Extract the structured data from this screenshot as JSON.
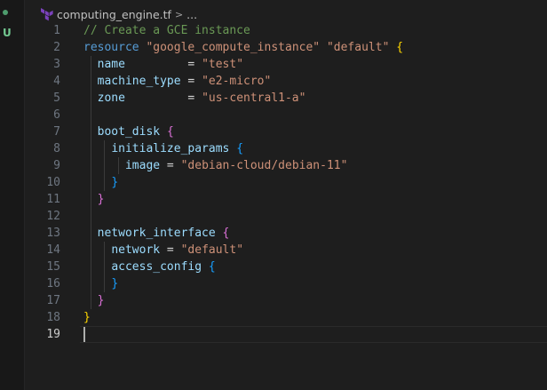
{
  "status": {
    "git_badge": "U"
  },
  "breadcrumb": {
    "file": "computing_engine.tf",
    "separator": ">",
    "more": "..."
  },
  "colors": {
    "comment": "#6a9955",
    "keyword": "#569cd6",
    "string": "#ce9178",
    "property": "#9cdcfe",
    "operator": "#d4d4d4",
    "bracket_1": "#ffd700",
    "bracket_2": "#da70d6",
    "bracket_3": "#179fff",
    "terraform_icon": "#7b42bc"
  },
  "editor": {
    "active_line": 19,
    "lines": [
      {
        "n": "1",
        "tokens": [
          {
            "t": "// Create a GCE instance",
            "c": "cm"
          }
        ]
      },
      {
        "n": "2",
        "tokens": [
          {
            "t": "resource ",
            "c": "kw"
          },
          {
            "t": "\"google_compute_instance\"",
            "c": "str"
          },
          {
            "t": " ",
            "c": "op"
          },
          {
            "t": "\"default\"",
            "c": "str"
          },
          {
            "t": " ",
            "c": "op"
          },
          {
            "t": "{",
            "c": "b1"
          }
        ]
      },
      {
        "n": "3",
        "tokens": [
          {
            "t": "  ",
            "c": "op"
          },
          {
            "t": "name",
            "c": "prop"
          },
          {
            "t": "         = ",
            "c": "op"
          },
          {
            "t": "\"test\"",
            "c": "str"
          }
        ]
      },
      {
        "n": "4",
        "tokens": [
          {
            "t": "  ",
            "c": "op"
          },
          {
            "t": "machine_type",
            "c": "prop"
          },
          {
            "t": " = ",
            "c": "op"
          },
          {
            "t": "\"e2-micro\"",
            "c": "str"
          }
        ]
      },
      {
        "n": "5",
        "tokens": [
          {
            "t": "  ",
            "c": "op"
          },
          {
            "t": "zone",
            "c": "prop"
          },
          {
            "t": "         = ",
            "c": "op"
          },
          {
            "t": "\"us-central1-a\"",
            "c": "str"
          }
        ]
      },
      {
        "n": "6",
        "tokens": []
      },
      {
        "n": "7",
        "tokens": [
          {
            "t": "  ",
            "c": "op"
          },
          {
            "t": "boot_disk",
            "c": "prop"
          },
          {
            "t": " ",
            "c": "op"
          },
          {
            "t": "{",
            "c": "b2"
          }
        ]
      },
      {
        "n": "8",
        "tokens": [
          {
            "t": "    ",
            "c": "op"
          },
          {
            "t": "initialize_params",
            "c": "prop"
          },
          {
            "t": " ",
            "c": "op"
          },
          {
            "t": "{",
            "c": "b3"
          }
        ]
      },
      {
        "n": "9",
        "tokens": [
          {
            "t": "      ",
            "c": "op"
          },
          {
            "t": "image",
            "c": "prop"
          },
          {
            "t": " = ",
            "c": "op"
          },
          {
            "t": "\"debian-cloud/debian-11\"",
            "c": "str"
          }
        ]
      },
      {
        "n": "10",
        "tokens": [
          {
            "t": "    ",
            "c": "op"
          },
          {
            "t": "}",
            "c": "b3"
          }
        ]
      },
      {
        "n": "11",
        "tokens": [
          {
            "t": "  ",
            "c": "op"
          },
          {
            "t": "}",
            "c": "b2"
          }
        ]
      },
      {
        "n": "12",
        "tokens": []
      },
      {
        "n": "13",
        "tokens": [
          {
            "t": "  ",
            "c": "op"
          },
          {
            "t": "network_interface",
            "c": "prop"
          },
          {
            "t": " ",
            "c": "op"
          },
          {
            "t": "{",
            "c": "b2"
          }
        ]
      },
      {
        "n": "14",
        "tokens": [
          {
            "t": "    ",
            "c": "op"
          },
          {
            "t": "network",
            "c": "prop"
          },
          {
            "t": " = ",
            "c": "op"
          },
          {
            "t": "\"default\"",
            "c": "str"
          }
        ]
      },
      {
        "n": "15",
        "tokens": [
          {
            "t": "    ",
            "c": "op"
          },
          {
            "t": "access_config",
            "c": "prop"
          },
          {
            "t": " ",
            "c": "op"
          },
          {
            "t": "{",
            "c": "b3"
          }
        ]
      },
      {
        "n": "16",
        "tokens": [
          {
            "t": "    ",
            "c": "op"
          },
          {
            "t": "}",
            "c": "b3"
          }
        ]
      },
      {
        "n": "17",
        "tokens": [
          {
            "t": "  ",
            "c": "op"
          },
          {
            "t": "}",
            "c": "b2"
          }
        ]
      },
      {
        "n": "18",
        "tokens": [
          {
            "t": "}",
            "c": "b1"
          }
        ]
      },
      {
        "n": "19",
        "tokens": []
      }
    ]
  }
}
